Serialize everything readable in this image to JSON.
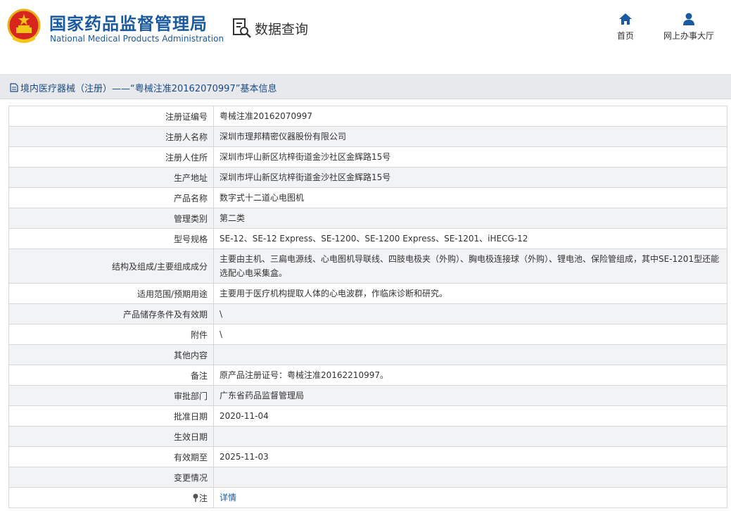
{
  "header": {
    "title": "国家药品监督管理局",
    "subtitle": "National Medical Products Administration",
    "query_label": "数据查询",
    "nav": [
      {
        "label": "首页",
        "icon": "home-icon"
      },
      {
        "label": "网上办事大厅",
        "icon": "user-icon"
      }
    ]
  },
  "breadcrumb": {
    "text": "境内医疗器械（注册）——“粤械注准20162070997”基本信息",
    "icon": "document-icon"
  },
  "rows": [
    {
      "label": "注册证编号",
      "value": "粤械注准20162070997"
    },
    {
      "label": "注册人名称",
      "value": "深圳市理邦精密仪器股份有限公司"
    },
    {
      "label": "注册人住所",
      "value": "深圳市坪山新区坑梓街道金沙社区金辉路15号"
    },
    {
      "label": "生产地址",
      "value": "深圳市坪山新区坑梓街道金沙社区金辉路15号"
    },
    {
      "label": "产品名称",
      "value": "数字式十二道心电图机"
    },
    {
      "label": "管理类别",
      "value": "第二类"
    },
    {
      "label": "型号规格",
      "value": "SE-12、SE-12 Express、SE-1200、SE-1200 Express、SE-1201、iHECG-12"
    },
    {
      "label": "结构及组成/主要组成成分",
      "value": "主要由主机、三扁电源线、心电图机导联线、四肢电极夹（外购）、胸电极连接球（外购）、锂电池、保险管组成，其中SE-1201型还能选配心电采集盒。"
    },
    {
      "label": "适用范围/预期用途",
      "value": "主要用于医疗机构提取人体的心电波群，作临床诊断和研究。"
    },
    {
      "label": "产品储存条件及有效期",
      "value": "\\"
    },
    {
      "label": "附件",
      "value": "\\"
    },
    {
      "label": "其他内容",
      "value": ""
    },
    {
      "label": "备注",
      "value": "原产品注册证号：粤械注准20162210997。"
    },
    {
      "label": "审批部门",
      "value": "广东省药品监督管理局"
    },
    {
      "label": "批准日期",
      "value": "2020-11-04"
    },
    {
      "label": "生效日期",
      "value": ""
    },
    {
      "label": "有效期至",
      "value": "2025-11-03"
    },
    {
      "label": "变更情况",
      "value": ""
    },
    {
      "label": "注",
      "value": "详情"
    }
  ],
  "colors": {
    "brand": "#1a5aa0",
    "breadcrumb_bg": "#e7e9ec",
    "row_alt": "#f2f3f5"
  }
}
